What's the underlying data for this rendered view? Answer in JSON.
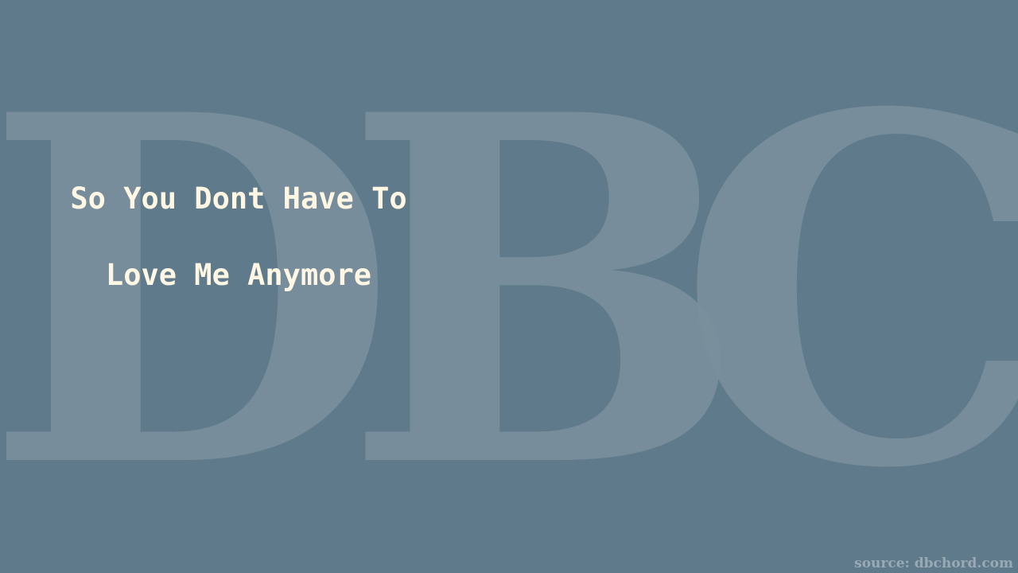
{
  "watermark": {
    "letters": [
      "D",
      "B",
      "C"
    ],
    "color": "#7a909d"
  },
  "background_color": "#5f7b8b",
  "song": {
    "title_line_1": "So You Dont Have To",
    "title_line_2": "Love Me Anymore",
    "text_color": "#fff6e3"
  },
  "source_label": "source: dbchord.com"
}
